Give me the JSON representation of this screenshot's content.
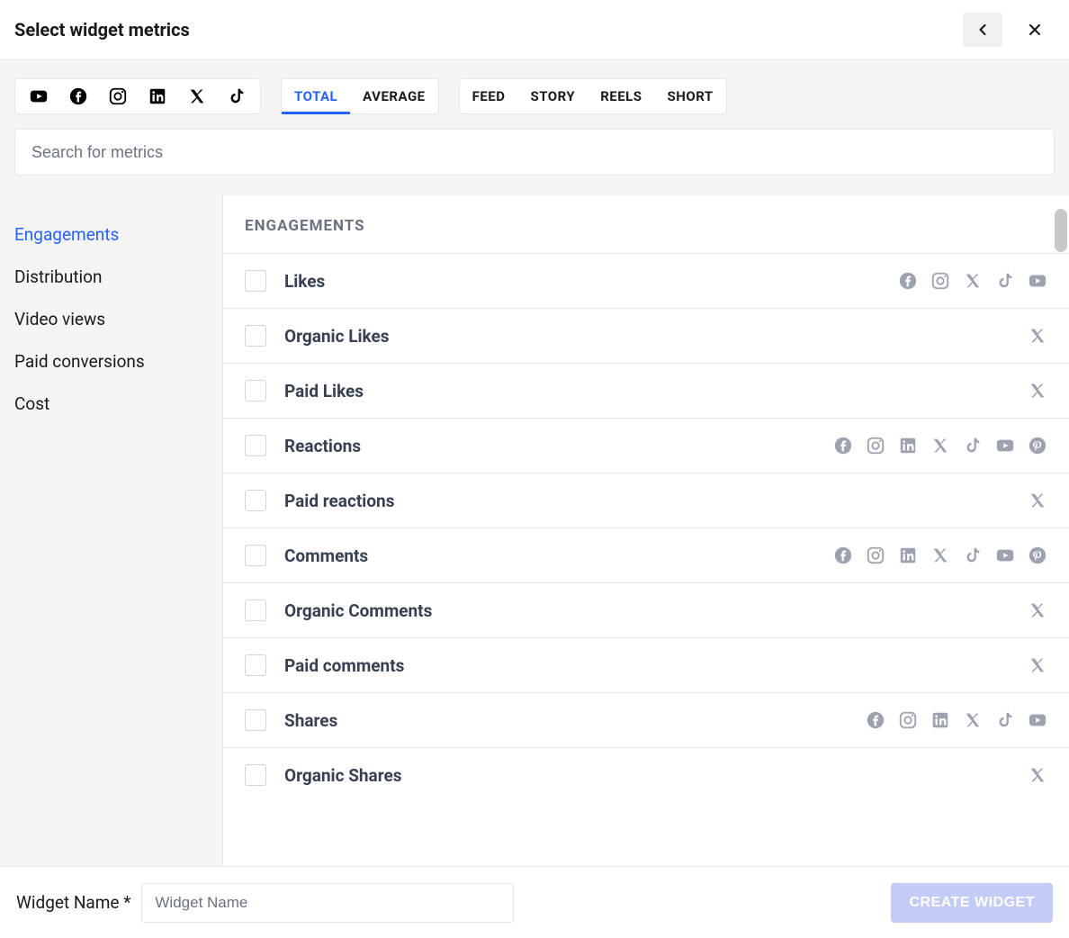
{
  "header": {
    "title": "Select widget metrics"
  },
  "platforms": {
    "youtube": "YouTube",
    "facebook": "Facebook",
    "instagram": "Instagram",
    "linkedin": "LinkedIn",
    "x": "X",
    "tiktok": "TikTok",
    "pinterest": "Pinterest"
  },
  "agg_tabs": {
    "total": "TOTAL",
    "average": "AVERAGE",
    "active": "total"
  },
  "content_tabs": {
    "feed": "FEED",
    "story": "STORY",
    "reels": "REELS",
    "short": "SHORT"
  },
  "search": {
    "placeholder": "Search for metrics"
  },
  "sidebar": {
    "items": [
      {
        "key": "engagements",
        "label": "Engagements",
        "active": true
      },
      {
        "key": "distribution",
        "label": "Distribution"
      },
      {
        "key": "video_views",
        "label": "Video views"
      },
      {
        "key": "paid_conversions",
        "label": "Paid conversions"
      },
      {
        "key": "cost",
        "label": "Cost"
      }
    ]
  },
  "section": {
    "heading": "ENGAGEMENTS"
  },
  "metrics": [
    {
      "label": "Likes",
      "platforms": [
        "facebook",
        "instagram",
        "x",
        "tiktok",
        "youtube"
      ]
    },
    {
      "label": "Organic Likes",
      "platforms": [
        "x"
      ]
    },
    {
      "label": "Paid Likes",
      "platforms": [
        "x"
      ]
    },
    {
      "label": "Reactions",
      "platforms": [
        "facebook",
        "instagram",
        "linkedin",
        "x",
        "tiktok",
        "youtube",
        "pinterest"
      ]
    },
    {
      "label": "Paid reactions",
      "platforms": [
        "x"
      ]
    },
    {
      "label": "Comments",
      "platforms": [
        "facebook",
        "instagram",
        "linkedin",
        "x",
        "tiktok",
        "youtube",
        "pinterest"
      ]
    },
    {
      "label": "Organic Comments",
      "platforms": [
        "x"
      ]
    },
    {
      "label": "Paid comments",
      "platforms": [
        "x"
      ]
    },
    {
      "label": "Shares",
      "platforms": [
        "facebook",
        "instagram",
        "linkedin",
        "x",
        "tiktok",
        "youtube"
      ]
    },
    {
      "label": "Organic Shares",
      "platforms": [
        "x"
      ]
    }
  ],
  "footer": {
    "name_label": "Widget Name *",
    "name_placeholder": "Widget Name",
    "create_label": "CREATE WIDGET"
  }
}
